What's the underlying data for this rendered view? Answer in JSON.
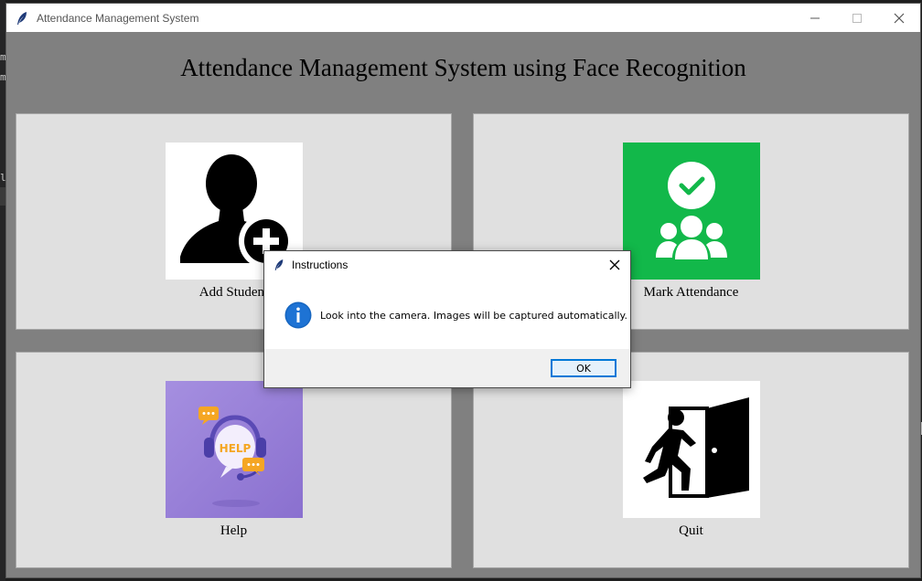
{
  "background": {
    "chars": [
      "m",
      "m",
      "lf"
    ]
  },
  "window": {
    "title": "Attendance Management System",
    "controls": [
      "minimize-icon",
      "maximize-icon",
      "close-icon"
    ]
  },
  "heading": "Attendance Management System using Face Recognition",
  "cards": {
    "add_student": {
      "label": "Add Student",
      "icon": "add-user-icon"
    },
    "mark_attendance": {
      "label": "Mark Attendance",
      "icon": "group-check-icon",
      "color": "#12b84a"
    },
    "help": {
      "label": "Help",
      "icon": "help-headset-icon",
      "color": "#9c84d8",
      "badge": "HELP"
    },
    "quit": {
      "label": "Quit",
      "icon": "exit-door-icon"
    }
  },
  "dialog": {
    "title": "Instructions",
    "message": "Look into the camera. Images will be captured automatically.",
    "ok_label": "OK",
    "accent": "#0078d7"
  }
}
